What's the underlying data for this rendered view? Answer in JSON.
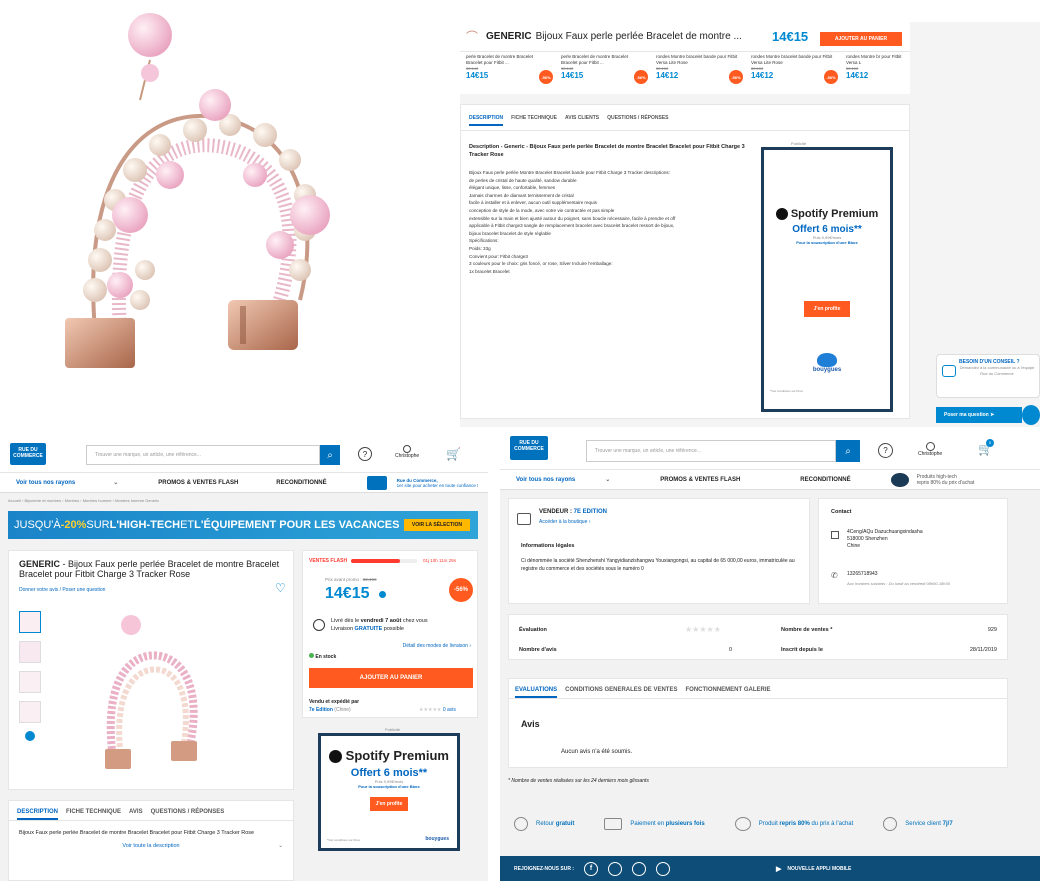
{
  "panel_tr": {
    "header_brand": "GENERIC",
    "header_title": "Bijoux Faux perle perlée Bracelet de montre ...",
    "header_price": "14€15",
    "header_cart": "AJOUTER AU PANIER",
    "carousel": [
      {
        "name": "perle Bracelet de montre Bracelet Bracelet pour Fitbit ...",
        "old": "32,14€",
        "price": "14€15",
        "badge": "-56%"
      },
      {
        "name": "perle Bracelet de montre Bracelet Bracelet pour Fitbit ...",
        "old": "32,14€",
        "price": "14€15",
        "badge": "-56%"
      },
      {
        "name": "rondes Montre bracelet bande pour Fitbit Versa Lite Rose",
        "old": "32,10€",
        "price": "14€12",
        "badge": "-56%"
      },
      {
        "name": "rondes Montre bracelet bande pour Fitbit Versa Lite Rose",
        "old": "32,10€",
        "price": "14€12",
        "badge": "-56%"
      },
      {
        "name": "rondes Montre br pour Fitbit Versa L",
        "old": "32,10€",
        "price": "14€12",
        "badge": ""
      }
    ],
    "tabs": [
      "DESCRIPTION",
      "FICHE TECHNIQUE",
      "AVIS CLIENTS",
      "QUESTIONS / RÉPONSES"
    ],
    "desc_title": "Description - Generic - Bijoux Faux perle perlée Bracelet de montre Bracelet Bracelet pour Fitbit Charge 3 Tracker Rose",
    "desc_lines": [
      "Bijoux Faux perle perlée Montre Bracelet Bracelet bande pour Fitbit Charge 3 Tracker descriptions:",
      "de perles de cristal de haute qualité, sandow durable",
      "élégant unique, lisse, confortable, femmes",
      "Jamais charmes de diamant ternissement de cristal",
      "facile à installer et à enlever, aucun outil supplémentaire requis",
      "conception de style de la mode, avec votre vie contractée et pas simple",
      "extensible sur la main et bien ajusté autour du poignet, sans boucle nécessaire, facile à prendre et off",
      "applicable à Fitbit charge3 sangle de remplacement bracelet avec bracelet bracelet ressort de bijoux,",
      "bijoux bracelet bracelet de style réglable",
      "Spécifications:",
      "Poids: 33g",
      "Convient pour: Fitbit charge3",
      "3 couleurs pour le choix: gris foncé, or rose, Silver Incluire l'emballage:",
      "1x bracelet Bracelet"
    ],
    "ad_pub": "Publicité",
    "ad_brand": "Spotify Premium",
    "ad_offer": "Offert 6 mois**",
    "ad_small": "Puis 9,99€/mois",
    "ad_link": "Pour la souscription d'une Bbox",
    "ad_btn": "J'en profite",
    "ad_bouygues": "bouygues",
    "ad_foot": "*Voir conditions sur bbox",
    "help_title": "BESOIN D'UN CONSEIL ?",
    "help_text": "Demandez à la communauté ou à l'équipe Rue du Commerce",
    "help_btn": "Poser ma question"
  },
  "panel_bl": {
    "logo": "RUE DU COMMERCE",
    "search_placeholder": "Trouver une marque, un article, une référence...",
    "user": "Christophe",
    "nav_rayons": "Voir tous nos rayons",
    "nav_promos": "PROMOS & VENTES FLASH",
    "nav_recond": "RECONDITIONNÉ",
    "nav_rdc": "Rue du Commerce,",
    "nav_rdc2": "1er site pour acheter en toute confiance !",
    "breadcrumb": "Accueil  ›  Bijouterie et montres  ›  Montres  ›  Montres homme  ›  Montres homme Generic",
    "banner_pre": "JUSQU'À ",
    "banner_pct": "-20%",
    "banner_mid": " SUR ",
    "banner_ht": "L'HIGH-TECH",
    "banner_et": " ET ",
    "banner_eq": "L'ÉQUIPEMENT POUR LES VACANCES",
    "banner_btn": "VOIR LA SÉLECTION",
    "brand": "GENERIC",
    "title": " - Bijoux Faux perle perlée Bracelet de montre Bracelet Bracelet pour Fitbit Charge 3 Tracker Rose",
    "review_link": "Donner votre avis / Poser une question",
    "flash": "VENTES FLASH",
    "timer": "01j 10h 11m 29s",
    "prix_label": "Prix avant promo :",
    "prix_old": "32,16€",
    "price": "14€15",
    "discount": "-56%",
    "delivery_pre": "Livré dès le ",
    "delivery_date": "vendredi 7 août",
    "delivery_post": " chez vous",
    "delivery_free_pre": "Livraison ",
    "delivery_free": "GRATUITE",
    "delivery_free_post": " possible",
    "delivery_link": "Détail des modes de livraison ›",
    "stock": "En stock",
    "cart_btn": "AJOUTER AU PANIER",
    "sold_by": "Vendu et expédié par",
    "seller": "7e Edition",
    "seller_country": "(Chine)",
    "seller_reviews": "0 avis",
    "ad_pub": "Publicité",
    "ad_brand": "Spotify Premium",
    "ad_offer": "Offert 6 mois**",
    "ad_small": "Puis 9,99€/mois",
    "ad_link": "Pour la souscription d'une Bbox",
    "ad_btn": "J'en profite",
    "ad_bouygues": "bouygues",
    "ad_foot": "*Voir conditions sur bbox",
    "tabs": [
      "DESCRIPTION",
      "FICHE TECHNIQUE",
      "AVIS",
      "QUESTIONS / RÉPONSES"
    ],
    "desc": "Bijoux Faux perle perlée Bracelet de montre Bracelet Bracelet pour Fitbit Charge 3 Tracker Rose",
    "see_all": "Voir toute la description"
  },
  "panel_br": {
    "logo": "RUE DU COMMERCE",
    "search_placeholder": "Trouver une marque, un article, une référence...",
    "user": "Christophe",
    "cart_count": "0",
    "nav_rayons": "Voir tous nos rayons",
    "nav_promos": "PROMOS & VENTES FLASH",
    "nav_recond": "RECONDITIONNÉ",
    "nav_ht": "Produits high-tech",
    "nav_ht2": "repris 80% du prix d'achat",
    "vendor_label": "VENDEUR : ",
    "vendor_name": "7E EDITION",
    "vendor_link": "Accéder à la boutique ›",
    "legal_title": "Informations légales",
    "legal_text": "Ci dénommée la société Shenzhenshi Yangyidianzishangwu Youxiangongsi, au capital de 65 000,00 euros, immatriculée au registre du commerce et des sociétés sous le numéro 0",
    "contact_title": "Contact",
    "address1": "4Ceng/AQu Dazuchuangxindasha",
    "address2": "518000 Shenzhen",
    "address3": "Chine",
    "phone": "13265718943",
    "hours": "Aux horaires suivants : Du lundi au vendredi 08h00-18h30",
    "eval_label": "Évaluation",
    "nb_avis_label": "Nombre d'avis",
    "nb_avis": "0",
    "ventes_label": "Nombre de ventes *",
    "ventes": "929",
    "inscrit_label": "Inscrit depuis le",
    "inscrit": "28/11/2019",
    "tabs": [
      "EVALUATIONS",
      "CONDITIONS GENERALES DE VENTES",
      "FONCTIONNEMENT GALERIE"
    ],
    "avis_title": "Avis",
    "avis_none": "Aucun avis n'a été soumis.",
    "footnote": "* Nombre de ventes réalisées sur les 24 derniers mois glissants",
    "features": [
      {
        "pre": "Retour ",
        "bold": "gratuit",
        "post": ""
      },
      {
        "pre": "Paiement en ",
        "bold": "plusieurs fois",
        "post": ""
      },
      {
        "pre": "Produit ",
        "bold": "repris 80%",
        "post": " du prix à l'achat"
      },
      {
        "pre": "Service client ",
        "bold": "7j/7",
        "post": ""
      }
    ],
    "footer_join": "REJOIGNEZ-NOUS SUR :",
    "footer_app": "NOUVELLE APPLI MOBILE"
  }
}
